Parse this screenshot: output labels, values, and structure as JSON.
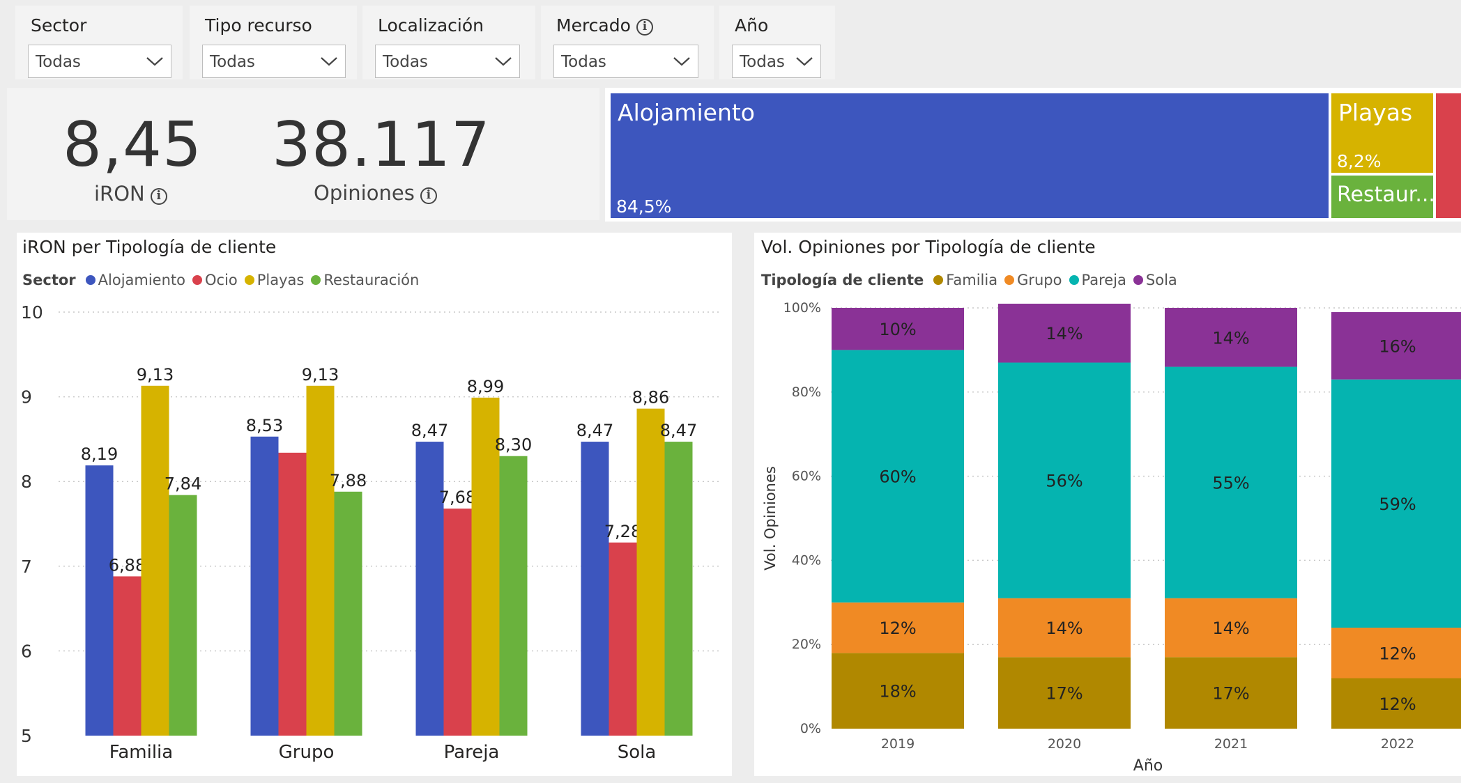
{
  "slicers": [
    {
      "title": "Sector",
      "value": "Todas",
      "info": false
    },
    {
      "title": "Tipo recurso",
      "value": "Todas",
      "info": false
    },
    {
      "title": "Localización",
      "value": "Todas",
      "info": false
    },
    {
      "title": "Mercado",
      "value": "Todas",
      "info": true
    },
    {
      "title": "Año",
      "value": "Todas",
      "info": false
    }
  ],
  "kpis": {
    "iron": {
      "value": "8,45",
      "label": "iRON"
    },
    "opiniones": {
      "value": "38.117",
      "label": "Opiniones"
    }
  },
  "treemap": {
    "items": [
      {
        "label": "Alojamiento",
        "pct": "84,5%",
        "color": "#3d56be"
      },
      {
        "label": "Playas",
        "pct": "8,2%",
        "color": "#d6b300"
      },
      {
        "label": "Restaur...",
        "pct": "",
        "color": "#6ab23d"
      },
      {
        "label": "",
        "pct": "",
        "color": "#d9414c"
      }
    ]
  },
  "iron_chart": {
    "title": "iRON per Tipología de cliente",
    "legend_title": "Sector"
  },
  "vol_chart": {
    "title": "Vol. Opiniones por Tipología de cliente",
    "legend_title": "Tipología de cliente"
  },
  "chart_data": [
    {
      "type": "bar",
      "title": "iRON per Tipología de cliente",
      "categories": [
        "Familia",
        "Grupo",
        "Pareja",
        "Sola"
      ],
      "series": [
        {
          "name": "Alojamiento",
          "color": "#3d56be",
          "values": [
            8.19,
            8.53,
            8.47,
            8.47
          ],
          "labels": [
            "8,19",
            "8,53",
            "8,47",
            "8,47"
          ]
        },
        {
          "name": "Ocio",
          "color": "#d9414c",
          "values": [
            6.88,
            8.34,
            7.68,
            7.28
          ],
          "labels": [
            "6,88",
            "",
            "7,68",
            "7,28"
          ]
        },
        {
          "name": "Playas",
          "color": "#d6b300",
          "values": [
            9.13,
            9.13,
            8.99,
            8.86
          ],
          "labels": [
            "9,13",
            "9,13",
            "8,99",
            "8,86"
          ]
        },
        {
          "name": "Restauración",
          "color": "#6ab23d",
          "values": [
            7.84,
            7.88,
            8.3,
            8.47
          ],
          "labels": [
            "7,84",
            "7,88",
            "8,30",
            "8,47"
          ]
        }
      ],
      "ylim": [
        5,
        10
      ],
      "yticks": [
        "5",
        "6",
        "7",
        "8",
        "9",
        "10"
      ],
      "grid": true,
      "legend": "top-left"
    },
    {
      "type": "bar",
      "stacked": "100%",
      "title": "Vol. Opiniones por Tipología de cliente",
      "xlabel": "Año",
      "ylabel": "Vol. Opiniones",
      "categories": [
        "2019",
        "2020",
        "2021",
        "2022"
      ],
      "series": [
        {
          "name": "Familia",
          "color": "#b08800",
          "values": [
            18,
            17,
            17,
            12
          ]
        },
        {
          "name": "Grupo",
          "color": "#f08a24",
          "values": [
            12,
            14,
            14,
            12
          ]
        },
        {
          "name": "Pareja",
          "color": "#05b4b0",
          "values": [
            60,
            56,
            55,
            59
          ]
        },
        {
          "name": "Sola",
          "color": "#8a3296",
          "values": [
            10,
            14,
            14,
            16
          ]
        }
      ],
      "ylim": [
        0,
        100
      ],
      "yticks": [
        "0%",
        "20%",
        "40%",
        "60%",
        "80%",
        "100%"
      ],
      "grid": true,
      "legend": "top-left"
    }
  ]
}
